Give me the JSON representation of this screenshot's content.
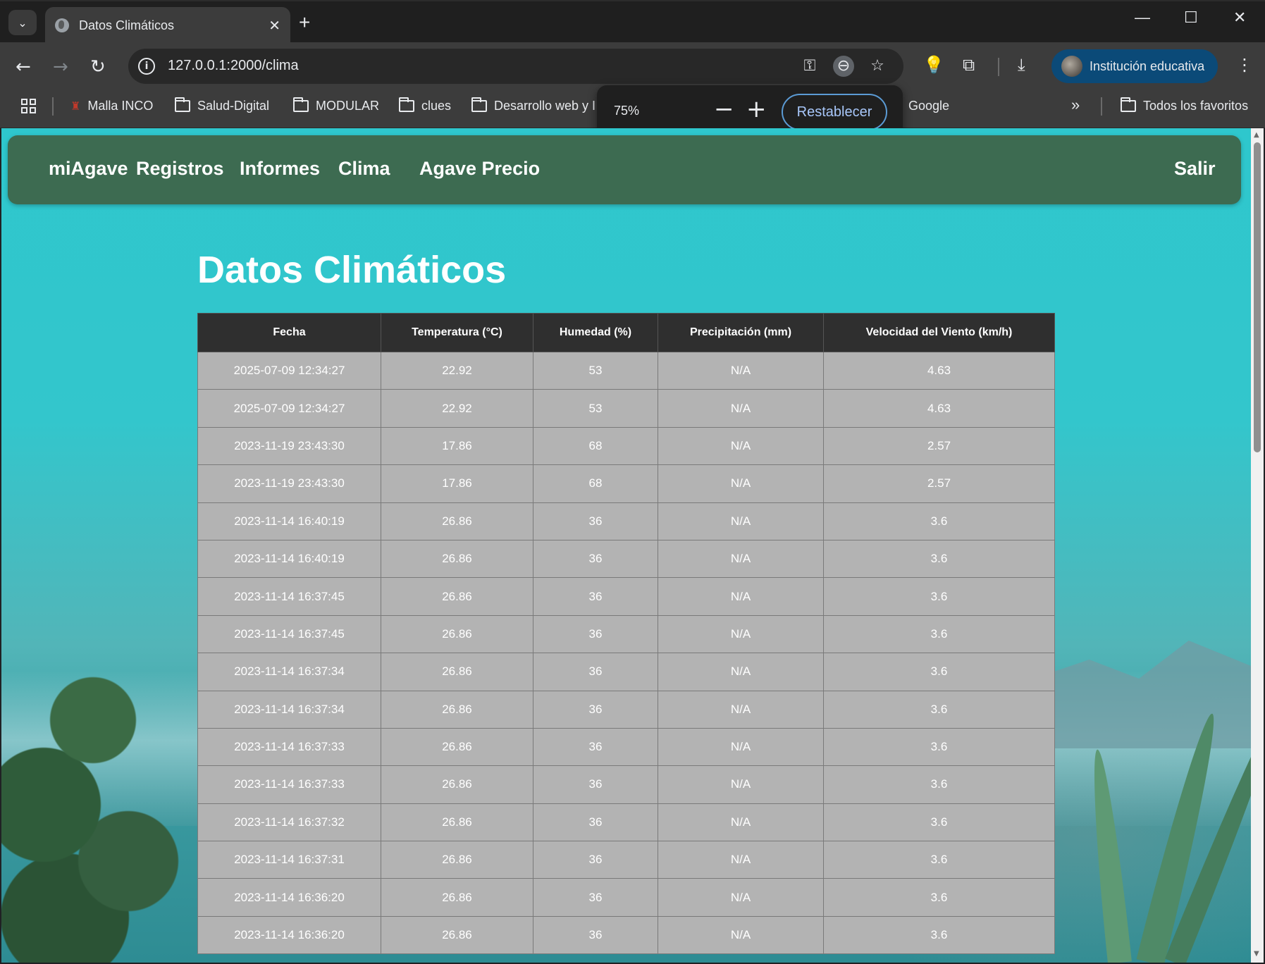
{
  "browser": {
    "tab_title": "Datos Climáticos",
    "tab_close": "✕",
    "new_tab": "+",
    "window_controls": {
      "minimize": "—",
      "maximize": "☐",
      "close": "✕"
    },
    "url": "127.0.0.1:2000/clima",
    "profile_label": "Institución educativa",
    "bookmarks": [
      {
        "label": "Malla INCO",
        "icon": "inco-favicon"
      },
      {
        "label": "Salud-Digital",
        "icon": "folder-icon"
      },
      {
        "label": "MODULAR",
        "icon": "folder-icon"
      },
      {
        "label": "clues",
        "icon": "folder-icon"
      },
      {
        "label": "Desarrollo web y I",
        "icon": "folder-icon"
      },
      {
        "label": "Google",
        "icon": "folder-icon"
      }
    ],
    "bookmarks_overflow": "»",
    "all_bookmarks": "Todos los favoritos",
    "zoom_popup": {
      "level": "75%",
      "minus": "−",
      "plus": "+",
      "reset": "Restablecer"
    }
  },
  "nav": {
    "brand": "miAgave",
    "links": [
      "Registros",
      "Informes",
      "Clima",
      "Agave Precio"
    ],
    "logout": "Salir"
  },
  "page": {
    "title": "Datos Climáticos"
  },
  "table": {
    "headers": [
      "Fecha",
      "Temperatura (°C)",
      "Humedad (%)",
      "Precipitación (mm)",
      "Velocidad del Viento (km/h)"
    ],
    "rows": [
      [
        "2025-07-09 12:34:27",
        "22.92",
        "53",
        "N/A",
        "4.63"
      ],
      [
        "2025-07-09 12:34:27",
        "22.92",
        "53",
        "N/A",
        "4.63"
      ],
      [
        "2023-11-19 23:43:30",
        "17.86",
        "68",
        "N/A",
        "2.57"
      ],
      [
        "2023-11-19 23:43:30",
        "17.86",
        "68",
        "N/A",
        "2.57"
      ],
      [
        "2023-11-14 16:40:19",
        "26.86",
        "36",
        "N/A",
        "3.6"
      ],
      [
        "2023-11-14 16:40:19",
        "26.86",
        "36",
        "N/A",
        "3.6"
      ],
      [
        "2023-11-14 16:37:45",
        "26.86",
        "36",
        "N/A",
        "3.6"
      ],
      [
        "2023-11-14 16:37:45",
        "26.86",
        "36",
        "N/A",
        "3.6"
      ],
      [
        "2023-11-14 16:37:34",
        "26.86",
        "36",
        "N/A",
        "3.6"
      ],
      [
        "2023-11-14 16:37:34",
        "26.86",
        "36",
        "N/A",
        "3.6"
      ],
      [
        "2023-11-14 16:37:33",
        "26.86",
        "36",
        "N/A",
        "3.6"
      ],
      [
        "2023-11-14 16:37:33",
        "26.86",
        "36",
        "N/A",
        "3.6"
      ],
      [
        "2023-11-14 16:37:32",
        "26.86",
        "36",
        "N/A",
        "3.6"
      ],
      [
        "2023-11-14 16:37:31",
        "26.86",
        "36",
        "N/A",
        "3.6"
      ],
      [
        "2023-11-14 16:36:20",
        "26.86",
        "36",
        "N/A",
        "3.6"
      ],
      [
        "2023-11-14 16:36:20",
        "26.86",
        "36",
        "N/A",
        "3.6"
      ]
    ]
  },
  "colors": {
    "nav_bg": "#3d6b51",
    "table_header_bg": "#2f2f2f",
    "table_cell_bg": "#b3b3b3",
    "profile_bg": "#0b4a78"
  }
}
